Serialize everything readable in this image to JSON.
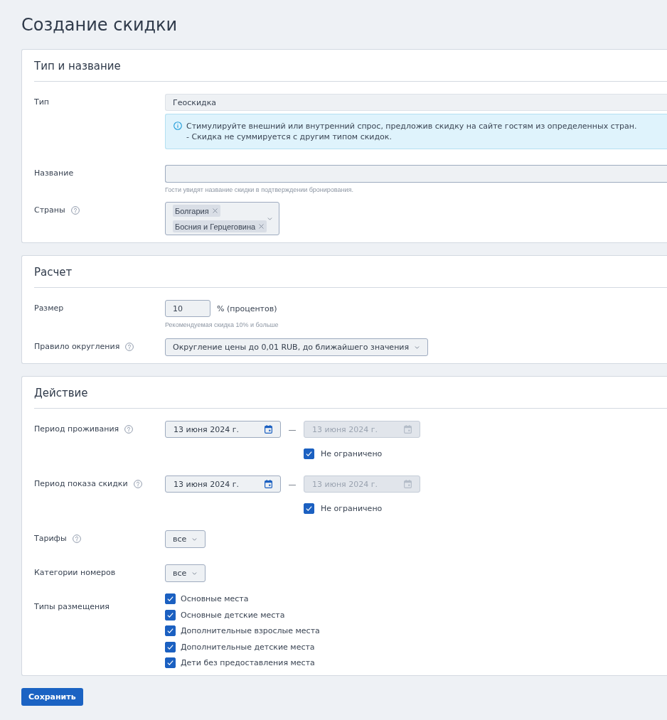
{
  "page_title": "Создание скидки",
  "sections": [
    {
      "title": "Тип и название",
      "fields": [
        {
          "kind": "readonly",
          "label": "Тип",
          "help": false,
          "value": "Геоскидка",
          "info": [
            "Стимулируйте внешний или внутренний спрос, предложив скидку на сайте гостям из определенных стран.",
            "- Скидка не суммируется с другим типом скидок."
          ]
        },
        {
          "kind": "text",
          "label": "Название",
          "help": false,
          "hint": "Гости увидят название скидки в подтверждении бронирования."
        },
        {
          "kind": "multiselect",
          "label": "Страны",
          "help": true,
          "tags": [
            "Болгария",
            "Босния и Герцеговина"
          ]
        }
      ]
    },
    {
      "title": "Расчет",
      "fields": [
        {
          "kind": "number",
          "label": "Размер",
          "help": false,
          "value": "10",
          "suffix": "% (процентов)",
          "hint": "Рекомендуемая скидка 10% и больше"
        },
        {
          "kind": "select",
          "label": "Правило округления",
          "help": true,
          "value": "Округление цены до 0,01 RUB, до ближайшего значения"
        }
      ]
    },
    {
      "title": "Действие",
      "fields": [
        {
          "kind": "period",
          "label": "Период проживания",
          "help": true,
          "start": {
            "value": "13 июня 2024 г.",
            "disabled": false
          },
          "separator": "—",
          "end": {
            "value": "13 июня 2024 г.",
            "disabled": true
          },
          "unlimited": {
            "label": "Не ограничено",
            "checked": true
          }
        },
        {
          "kind": "period",
          "label": "Период показа скидки",
          "help": true,
          "start": {
            "value": "13 июня 2024 г.",
            "disabled": false
          },
          "separator": "—",
          "end": {
            "value": "13 июня 2024 г.",
            "disabled": true
          },
          "unlimited": {
            "label": "Не ограничено",
            "checked": true
          }
        },
        {
          "kind": "dropdown",
          "label": "Тарифы",
          "help": true,
          "value": "все"
        },
        {
          "kind": "dropdown",
          "label": "Категории номеров",
          "help": false,
          "value": "все"
        },
        {
          "kind": "checklist",
          "label": "Типы размещения",
          "help": false,
          "options": [
            {
              "label": "Основные места",
              "checked": true
            },
            {
              "label": "Основные детские места",
              "checked": true
            },
            {
              "label": "Дополнительные взрослые места",
              "checked": true
            },
            {
              "label": "Дополнительные детские места",
              "checked": true
            },
            {
              "label": "Дети без предоставления места",
              "checked": true
            }
          ]
        }
      ]
    }
  ],
  "save_button": "Сохранить"
}
